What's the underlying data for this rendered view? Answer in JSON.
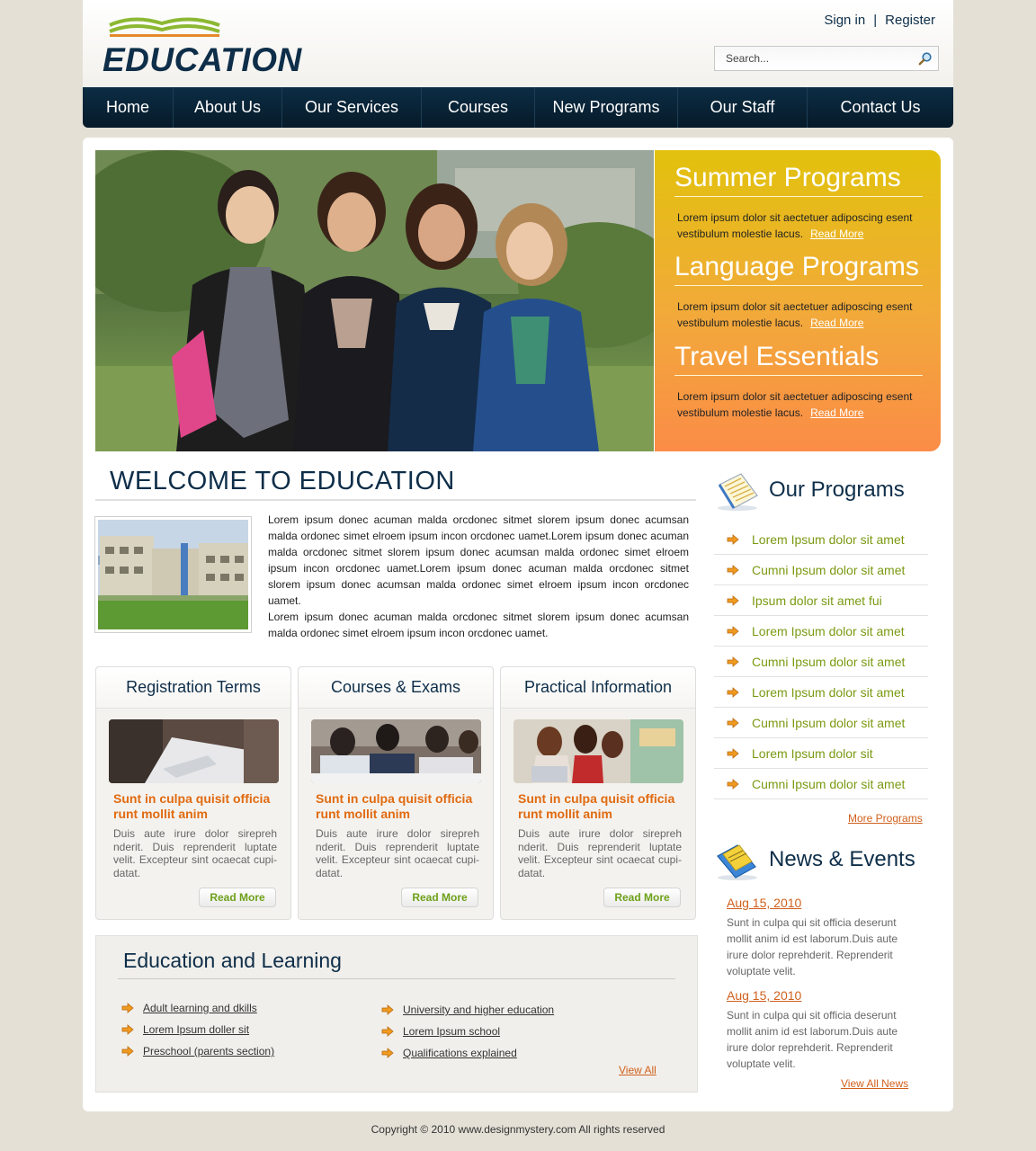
{
  "header": {
    "logo_text": "EDUCATION",
    "sign_in": "Sign in",
    "separator": "|",
    "register": "Register",
    "search_placeholder": "Search...",
    "search_icon": "magnifier-icon"
  },
  "nav": {
    "items": [
      {
        "label": "Home"
      },
      {
        "label": "About Us"
      },
      {
        "label": "Our Services"
      },
      {
        "label": "Courses"
      },
      {
        "label": "New Programs"
      },
      {
        "label": "Our Staff"
      },
      {
        "label": "Contact Us"
      }
    ]
  },
  "banner": {
    "promos": [
      {
        "title": "Summer Programs",
        "text": "Lorem ipsum dolor sit aectetuer adiposcing esent vestibulum molestie lacus.",
        "link": "Read More"
      },
      {
        "title": "Language Programs",
        "text": "Lorem ipsum dolor sit aectetuer adiposcing esent vestibulum molestie lacus.",
        "link": "Read More"
      },
      {
        "title": "Travel Essentials",
        "text": "Lorem ipsum dolor sit aectetuer adiposcing esent vestibulum molestie lacus.",
        "link": "Read More"
      }
    ]
  },
  "welcome": {
    "title": "WELCOME TO EDUCATION",
    "paragraph1": "Lorem ipsum donec acuman malda orcdonec sitmet slorem ipsum donec acumsan malda ordonec simet elroem ipsum incon orcdonec uamet.Lorem ipsum donec acuman malda orcdonec sitmet slorem ipsum donec acumsan malda ordonec simet elroem ipsum incon orcdonec uamet.Lorem ipsum donec acuman malda orcdonec sitmet slorem ipsum donec acumsan malda ordonec simet elroem ipsum incon orcdonec uamet.",
    "paragraph2": "Lorem ipsum donec acuman malda orcdonec sitmet slorem ipsum donec acumsan malda ordonec simet elroem ipsum incon orcdonec uamet."
  },
  "boxes": [
    {
      "title": "Registration Terms",
      "heading": "Sunt in culpa quisit officia runt mollit anim",
      "text": "Duis aute irure dolor sirepreh nderit. Duis reprenderit luptate velit. Excepteur sint ocaecat cupi-datat.",
      "button": "Read More"
    },
    {
      "title": "Courses & Exams",
      "heading": "Sunt in culpa quisit officia runt mollit anim",
      "text": "Duis aute irure dolor sirepreh nderit. Duis reprenderit luptate velit. Excepteur sint ocaecat cupi-datat.",
      "button": "Read More"
    },
    {
      "title": "Practical Information",
      "heading": "Sunt in culpa quisit officia runt mollit anim",
      "text": "Duis aute irure dolor sirepreh nderit. Duis reprenderit luptate velit. Excepteur sint ocaecat cupi-datat.",
      "button": "Read More"
    }
  ],
  "education": {
    "title": "Education and Learning",
    "left_links": [
      "Adult learning and dkills",
      "Lorem Ipsum doller sit",
      "Preschool (parents section)"
    ],
    "right_links": [
      "University and higher education",
      "Lorem Ipsum school",
      "Qualifications explained"
    ],
    "view_all": "View All"
  },
  "programs": {
    "title": "Our Programs",
    "icon": "notepad-icon",
    "items": [
      "Lorem Ipsum dolor sit amet",
      "Cumni Ipsum dolor sit amet",
      "Ipsum dolor sit amet fui",
      "Lorem Ipsum dolor sit amet",
      "Cumni Ipsum dolor sit amet",
      "Lorem Ipsum dolor sit amet",
      "Cumni Ipsum dolor sit amet",
      "Lorem Ipsum dolor sit",
      "Cumni Ipsum dolor sit amet"
    ],
    "more_link": "More Programs"
  },
  "news": {
    "title": "News & Events",
    "icon": "folder-news-icon",
    "items": [
      {
        "date": "Aug 15, 2010",
        "text": "Sunt in culpa qui sit officia deserunt mollit anim id est laborum.Duis aute irure dolor reprehderit. Reprenderit voluptate velit."
      },
      {
        "date": "Aug 15, 2010",
        "text": "Sunt in culpa qui sit officia deserunt mollit anim id est laborum.Duis aute irure dolor reprehderit. Reprenderit voluptate velit."
      }
    ],
    "view_all": "View All News"
  },
  "footer": {
    "copyright": "Copyright © 2010 www.designmystery.com  All rights reserved"
  },
  "colors": {
    "navy": "#0e2e49",
    "accent_orange": "#e06a10",
    "link_orange": "#d0601c",
    "program_green": "#7a9a12",
    "banner_gradient_top": "#e2c20d",
    "banner_gradient_bottom": "#fb8c47"
  }
}
